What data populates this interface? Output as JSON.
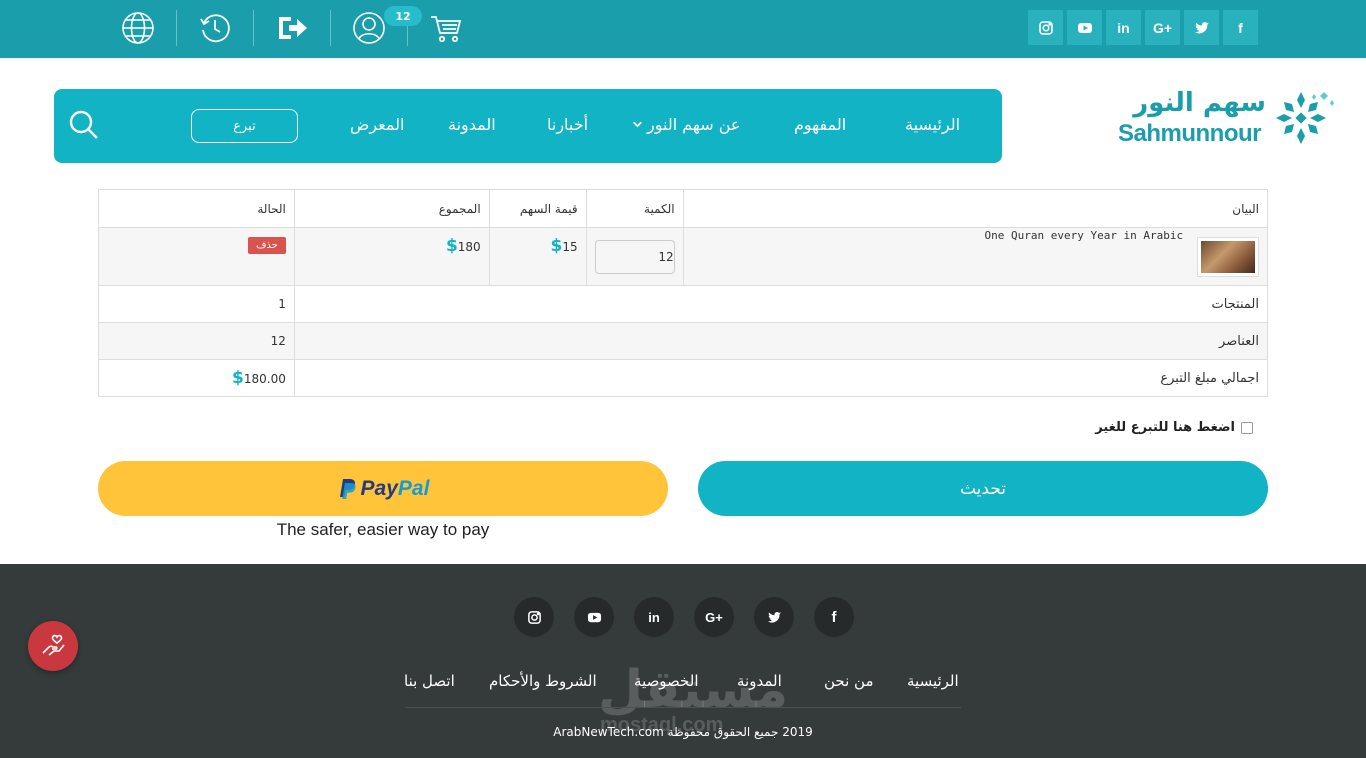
{
  "topbar": {
    "cart_count": "12",
    "icons": [
      "globe-icon",
      "history-icon",
      "logout-icon",
      "user-icon",
      "cart-icon"
    ],
    "social": [
      "facebook",
      "twitter",
      "google-plus",
      "linkedin",
      "youtube",
      "instagram"
    ]
  },
  "logo": {
    "arabic": "سهم النور",
    "english": "Sahmunnour"
  },
  "nav": {
    "items": [
      "الرئيسية",
      "المفهوم",
      "عن سهم النور",
      "أخبارنا",
      "المدونة",
      "المعرض"
    ],
    "donate": "تبرع"
  },
  "cart": {
    "headers": {
      "desc": "البيان",
      "qty": "الكمية",
      "price": "قيمة السهم",
      "total": "المجموع",
      "status": "الحالة"
    },
    "item": {
      "name": "One Quran every Year in Arabic",
      "qty": "12",
      "price": "15",
      "total": "180",
      "delete": "حذف"
    },
    "summary": [
      {
        "label": "المنتجات",
        "value": "1"
      },
      {
        "label": "العناصر",
        "value": "12"
      },
      {
        "label": "اجمالي مبلغ التبرع",
        "value": "180.00"
      }
    ],
    "currency": "$"
  },
  "gift_label": "اضغط هنا للتبرع للغير",
  "update_label": "تحديث",
  "paypal": {
    "brand_a": "Pay",
    "brand_b": "Pal",
    "tagline": "The safer, easier way to pay"
  },
  "footer": {
    "links": [
      "الرئيسية",
      "من نحن",
      "المدونة",
      "الخصوصية",
      "الشروط والأحكام",
      "اتصل بنا"
    ],
    "copyright": "2019 جميع الحقوق محفوظة ArabNewTech.com",
    "watermark": "مستقل",
    "watermark_sub": "mostaql.com"
  },
  "colors": {
    "primary": "#12b3c4",
    "topbar": "#1a9eab",
    "footer": "#353a3b",
    "paypal": "#ffc439",
    "danger": "#d9534f"
  }
}
